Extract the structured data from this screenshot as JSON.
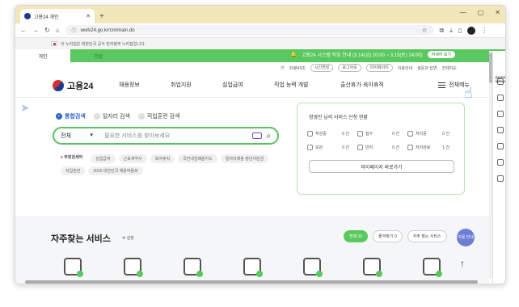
{
  "browser": {
    "tab_title": "고용24 개인",
    "url": "work24.go.kr/cm/main.do",
    "new_tab": "+",
    "controls": [
      "—",
      "▢",
      "✕"
    ]
  },
  "gov_notice": "이 누리집은 대한민국 공식 전자정부 누리집입니다.",
  "user_tabs": [
    {
      "label": "개인",
      "active": true
    },
    {
      "label": "기업",
      "active": false
    }
  ],
  "banner": {
    "text": "고용24 시스템 작업 안내 (3.14(금) 20:00 ~ 3.15(토) 24:00)",
    "more": "자세히 보기"
  },
  "utility": {
    "time": "29분45초",
    "extend": "시간연장",
    "logout": "로그아웃",
    "mypage": "마이페이지",
    "guide": "이용안내",
    "qna": "질문과 답변",
    "sitemap": "전체지도"
  },
  "logo": "고용24",
  "gnb": [
    "채용정보",
    "취업지원",
    "실업급여",
    "직업 능력 개발",
    "출산휴가·육아휴직"
  ],
  "all_menu": "전체메뉴",
  "search_options": [
    {
      "label": "통합검색",
      "on": true
    },
    {
      "label": "일자리 검색",
      "on": false
    },
    {
      "label": "직업훈련 검색",
      "on": false
    }
  ],
  "search": {
    "select": "전체",
    "placeholder": "필요한 서비스를 찾아보세요"
  },
  "recommend_label": "추천검색어",
  "recommend": [
    "실업급여",
    "근로계약서",
    "육아휴직",
    "국민내일배움카드",
    "일자리채움 청년지원금",
    "직업훈련",
    "2025 대한민국 채용박람회"
  ],
  "status": {
    "title": "정영진 님의 서비스 신청 현황",
    "items": [
      {
        "label": "작성중",
        "count": "0 건"
      },
      {
        "label": "접수",
        "count": "0 건"
      },
      {
        "label": "처리중",
        "count": "0 건"
      },
      {
        "label": "보완",
        "count": "0 건"
      },
      {
        "label": "반려",
        "count": "0 건"
      },
      {
        "label": "처리완료",
        "count": "1 건"
      }
    ],
    "mypage_btn": "마이페이지 바로가기"
  },
  "favorites": {
    "title": "자주찾는 서비스",
    "setting": "⊕ 설정",
    "tabs": [
      {
        "label": "전체 10",
        "on": true
      },
      {
        "label": "즐겨찾기 0",
        "on": false
      },
      {
        "label": "자주 찾는 서비스",
        "on": false
      }
    ],
    "move_guide": "이용 안내"
  },
  "quick_menu": "QUICK MENU"
}
